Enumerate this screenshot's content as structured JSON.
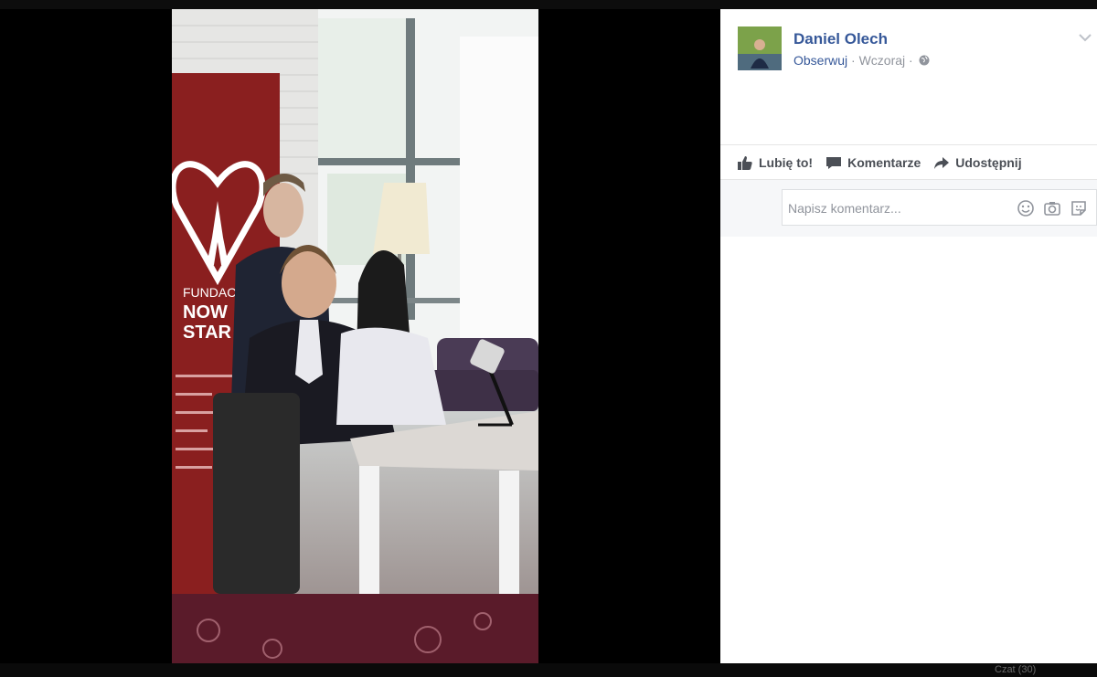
{
  "post": {
    "author": "Daniel Olech",
    "follow_label": "Obserwuj",
    "separator": " · ",
    "time": "Wczoraj",
    "privacy_icon": "globe-icon"
  },
  "actions": {
    "like_label": "Lubię to!",
    "comment_label": "Komentarze",
    "share_label": "Udostępnij"
  },
  "comment": {
    "placeholder": "Napisz komentarz...",
    "icons": [
      "emoji-icon",
      "camera-icon",
      "sticker-icon"
    ]
  },
  "photo_texts": {
    "banner_line1": "FUNDAC",
    "banner_line2": "NOW",
    "banner_line3": "STAR"
  },
  "chat_bar": {
    "label": "Czat (30)"
  },
  "colors": {
    "link": "#365899",
    "muted": "#90949c",
    "action_text": "#4b4f56",
    "banner_red": "#8a1f1f"
  }
}
